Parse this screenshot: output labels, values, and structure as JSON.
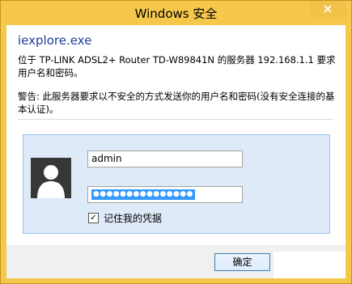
{
  "window": {
    "title": "Windows 安全",
    "accent_color": "#f5c84c"
  },
  "dialog": {
    "app_name": "iexplore.exe",
    "message": "位于 TP-LINK ADSL2+ Router TD-W89841N 的服务器 192.168.1.1 要求用户名和密码。",
    "warning": "警告: 此服务器要求以不安全的方式发送你的用户名和密码(没有安全连接的基本认证)。"
  },
  "credentials": {
    "avatar_icon": "user-silhouette-icon",
    "username_value": "admin",
    "password_mask": "●●●●●●●●●●●●●●●",
    "remember_label": "记住我的凭据",
    "remember_checked": "✓"
  },
  "footer": {
    "ok_label": "确定"
  },
  "icons": {
    "close": "close-icon"
  }
}
